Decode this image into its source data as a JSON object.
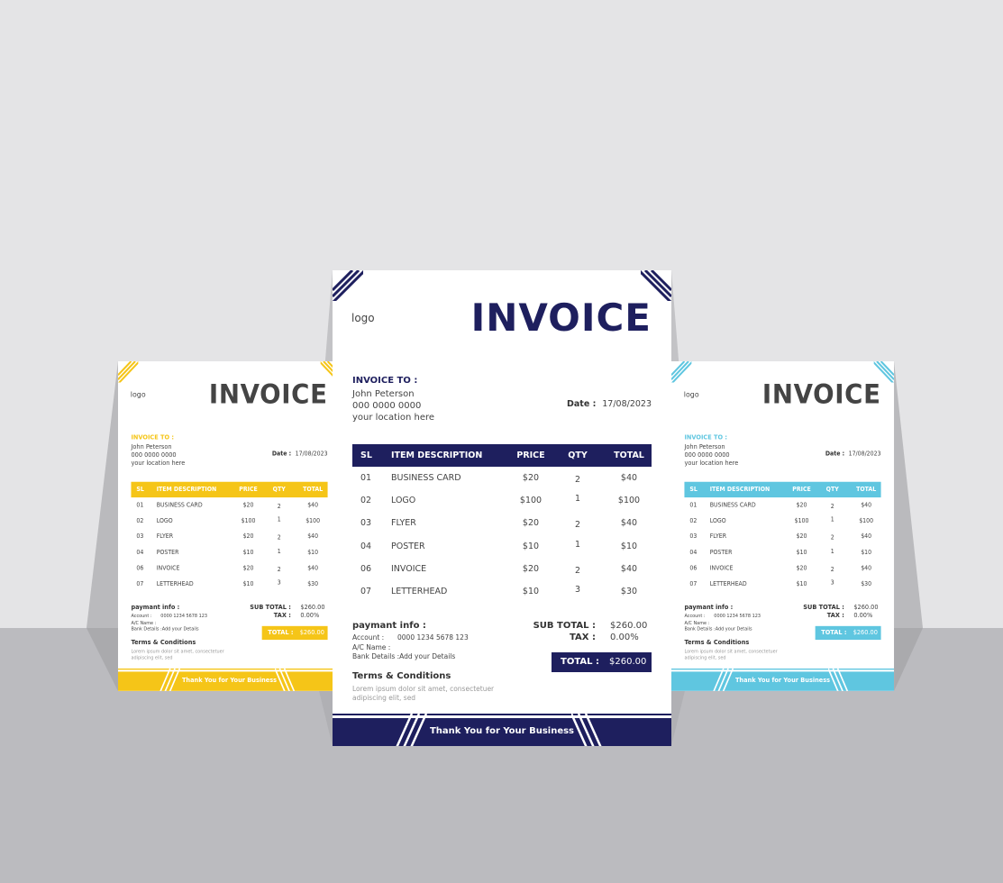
{
  "invoice": {
    "logo": "logo",
    "title": "INVOICE",
    "invoice_to_label": "INVOICE TO :",
    "client_name": "John Peterson",
    "client_phone": "000 0000 0000",
    "client_location": "your location here",
    "date_label": "Date :",
    "date_value": "17/08/2023",
    "columns": [
      "SL",
      "ITEM DESCRIPTION",
      "PRICE",
      "QTY",
      "TOTAL"
    ],
    "rows": [
      [
        "01",
        "BUSINESS CARD",
        "$20",
        "2",
        "$40"
      ],
      [
        "02",
        "LOGO",
        "$100",
        "1",
        "$100"
      ],
      [
        "03",
        "FLYER",
        "$20",
        "2",
        "$40"
      ],
      [
        "04",
        "POSTER",
        "$10",
        "1",
        "$10"
      ],
      [
        "06",
        "INVOICE",
        "$20",
        "2",
        "$40"
      ],
      [
        "07",
        "LETTERHEAD",
        "$10",
        "3",
        "$30"
      ]
    ],
    "payment_label": "paymant info  :",
    "account_label": "Account :",
    "account_value": "0000 1234 5678 123",
    "ac_name_label": "A/C Name :",
    "bank_details": "Bank Details :Add your Details",
    "sub_total_label": "SUB TOTAL :",
    "sub_total_value": "$260.00",
    "tax_label": "TAX :",
    "tax_value": "0.00%",
    "total_label": "TOTAL :",
    "total_value": "$260.00",
    "terms_label": "Terms & Conditions",
    "terms_text": "Lorem ipsum dolor sit amet, consectetuer adipiscing elit, sed",
    "footer": "Thank You for Your Business"
  },
  "variants": [
    {
      "id": "yellow",
      "accent": "#f5c518",
      "title_color": "#444444"
    },
    {
      "id": "cyan",
      "accent": "#5fc6e0",
      "title_color": "#444444"
    },
    {
      "id": "navy",
      "accent": "#1e1f5e",
      "title_color": "#1e1f5e"
    }
  ]
}
